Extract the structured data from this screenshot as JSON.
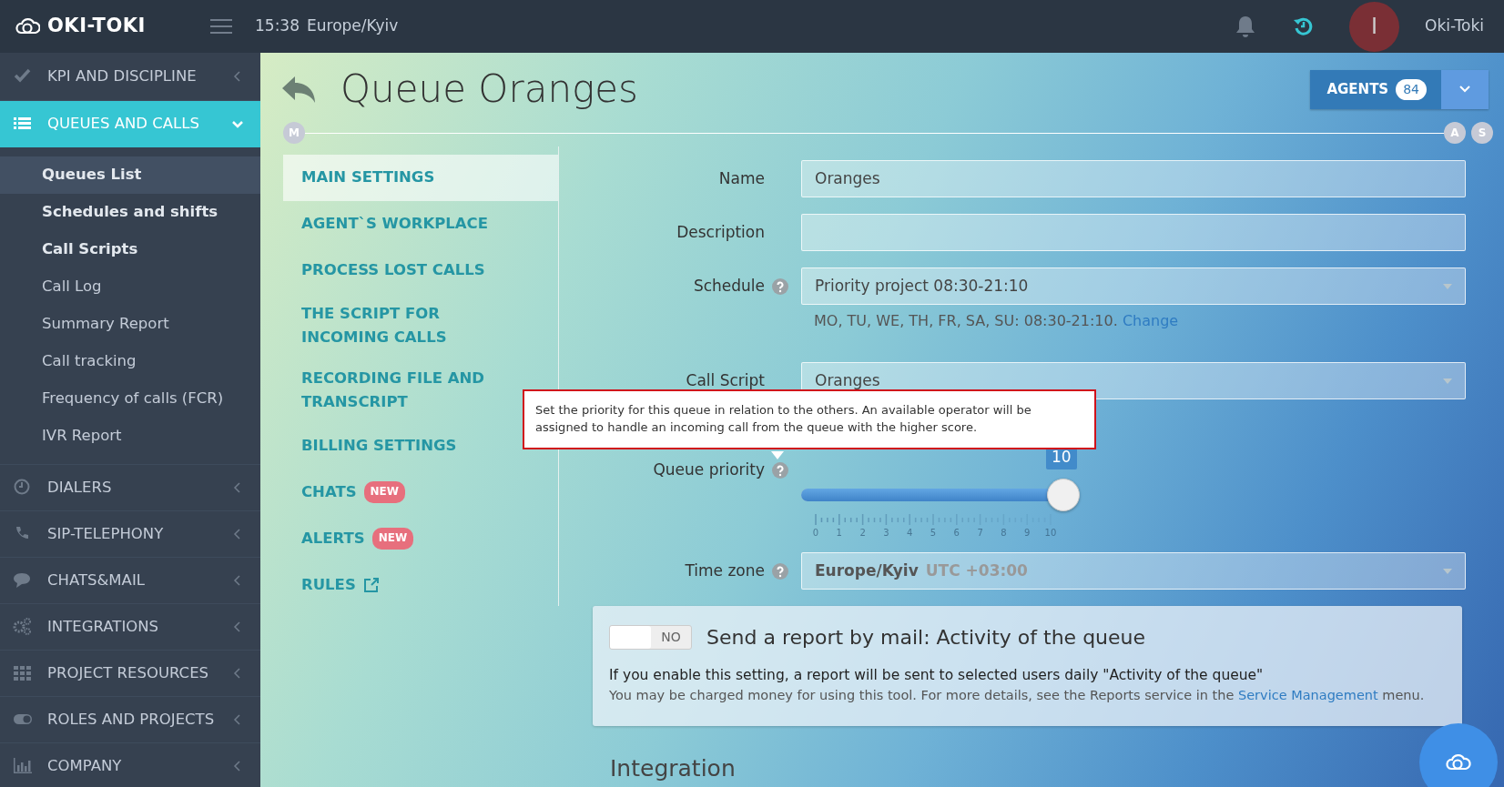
{
  "topbar": {
    "brand": "OKI-TOKI",
    "clock": "15:38",
    "timezone": "Europe/Kyiv",
    "avatar_letter": "I",
    "user": "Oki-Toki"
  },
  "sidebar": {
    "items": [
      {
        "label": "KPI AND DISCIPLINE",
        "expanded": false
      },
      {
        "label": "QUEUES AND CALLS",
        "expanded": true,
        "children": [
          {
            "label": "Queues List",
            "bold": true,
            "selected": true
          },
          {
            "label": "Schedules and shifts",
            "bold": true,
            "selected": false
          },
          {
            "label": "Call Scripts",
            "bold": true,
            "selected": false
          },
          {
            "label": "Call Log",
            "bold": false,
            "selected": false
          },
          {
            "label": "Summary Report",
            "bold": false,
            "selected": false
          },
          {
            "label": "Call tracking",
            "bold": false,
            "selected": false
          },
          {
            "label": "Frequency of calls (FCR)",
            "bold": false,
            "selected": false
          },
          {
            "label": "IVR Report",
            "bold": false,
            "selected": false
          }
        ]
      },
      {
        "label": "DIALERS",
        "expanded": false
      },
      {
        "label": "SIP-TELEPHONY",
        "expanded": false
      },
      {
        "label": "CHATS&MAIL",
        "expanded": false
      },
      {
        "label": "INTEGRATIONS",
        "expanded": false
      },
      {
        "label": "PROJECT RESOURCES",
        "expanded": false
      },
      {
        "label": "ROLES AND PROJECTS",
        "expanded": false
      },
      {
        "label": "COMPANY",
        "expanded": false
      }
    ]
  },
  "page": {
    "title": "Queue Oranges",
    "agents_button": {
      "label": "AGENTS",
      "count": "84"
    },
    "timeline": {
      "start": "M",
      "end": [
        "A",
        "S"
      ]
    }
  },
  "tabs": [
    {
      "label": "MAIN SETTINGS",
      "selected": true
    },
    {
      "label": "AGENT`S WORKPLACE",
      "selected": false
    },
    {
      "label": "PROCESS LOST CALLS",
      "selected": false
    },
    {
      "label": "THE SCRIPT FOR INCOMING CALLS",
      "selected": false
    },
    {
      "label": "RECORDING FILE AND TRANSCRIPT",
      "selected": false
    },
    {
      "label": "BILLING SETTINGS",
      "selected": false
    },
    {
      "label": "CHATS",
      "selected": false,
      "badge": "NEW"
    },
    {
      "label": "ALERTS",
      "selected": false,
      "badge": "NEW"
    },
    {
      "label": "RULES",
      "selected": false,
      "external": true
    }
  ],
  "form": [
    {
      "kind": "text",
      "label": "Name",
      "value": "Oranges"
    },
    {
      "kind": "text",
      "label": "Description"
    },
    {
      "kind": "select",
      "label": "Schedule",
      "help": true,
      "value": "Priority project 08:30-21:10",
      "note": "MO, TU, WE, TH, FR, SA, SU: 08:30-21:10.",
      "note_link": "Change"
    },
    {
      "kind": "select",
      "label": "Call Script",
      "value": "Oranges"
    },
    {
      "kind": "slider",
      "label": "Queue priority",
      "help": true,
      "level": 1,
      "reading": "10",
      "ticks": [
        "0",
        "1",
        "2",
        "3",
        "4",
        "5",
        "6",
        "7",
        "8",
        "9",
        "10"
      ]
    },
    {
      "kind": "select",
      "label": "Time zone",
      "help": true,
      "value": "Europe/Kyiv",
      "value_extra": "UTC +03:00"
    }
  ],
  "tooltip": {
    "text": "Set the priority for this queue in relation to the others. An available operator will be assigned to handle an incoming call from the queue with the higher score."
  },
  "report": {
    "switch_label": "NO",
    "on": false,
    "title": "Send a report by mail: Activity of the queue",
    "lead": "If you enable this setting, a report will be sent to selected users daily \"Activity of the queue\"",
    "note": "You may be charged money for using this tool. For more details, see the Reports service in the ",
    "link": "Service Management",
    "note_end": " menu."
  },
  "section_heading": "Integration"
}
